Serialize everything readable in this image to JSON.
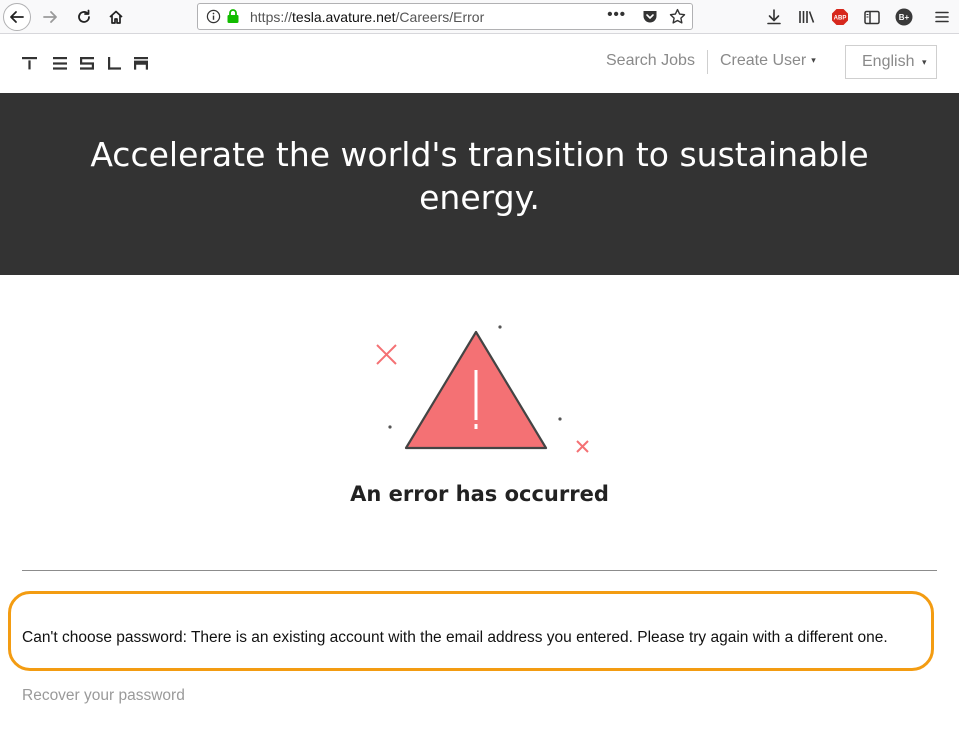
{
  "browser": {
    "url_prefix": "https://",
    "url_host": "tesla.avature.net",
    "url_path": "/Careers/Error",
    "more_label": "•••",
    "abp_label": "ABP",
    "bplus_label": "B+"
  },
  "header": {
    "nav_search_jobs": "Search Jobs",
    "nav_create_user": "Create User",
    "language": "English",
    "caret": "▾"
  },
  "hero": {
    "title": "Accelerate the world's transition to sustainable energy."
  },
  "error": {
    "heading": "An error has occurred",
    "message": "Can't choose password: There is an existing account with the email address you entered. Please try again with a different one.",
    "recover_link": "Recover your password"
  },
  "colors": {
    "hero_bg": "#333333",
    "warning_fill": "#f47174",
    "highlight_border": "#f39c12",
    "ssl_lock": "#12bc00"
  }
}
